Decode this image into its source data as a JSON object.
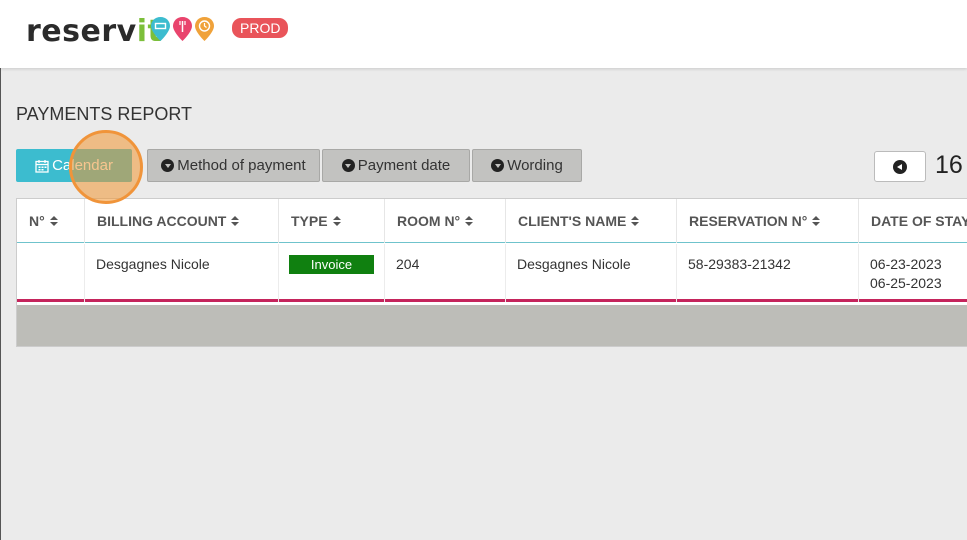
{
  "app": {
    "logo_main": "reserv",
    "logo_accent": "it",
    "env_badge": "PROD",
    "pin_colors": [
      "#3cbccf",
      "#e9446d",
      "#f0a23a"
    ]
  },
  "page": {
    "title": "PAYMENTS REPORT"
  },
  "filters": {
    "calendar": "Calendar",
    "method_of_payment": "Method of payment",
    "payment_date": "Payment date",
    "wording": "Wording"
  },
  "pager": {
    "current": "16"
  },
  "table": {
    "headers": [
      "N°",
      "BILLING ACCOUNT",
      "TYPE",
      "ROOM N°",
      "CLIENT'S NAME",
      "RESERVATION N°",
      "DATE OF STAY"
    ],
    "rows": [
      {
        "n": "",
        "billing_account": "Desgagnes Nicole",
        "type": "Invoice",
        "room": "204",
        "client_name": "Desgagnes Nicole",
        "reservation": "58-29383-21342",
        "date_from": "06-23-2023",
        "date_to": "06-25-2023"
      }
    ]
  },
  "colors": {
    "calendar_button": "#3cbccf",
    "invoice_badge": "#108010",
    "row_divider": "#c5245c",
    "env_badge": "#e9545a"
  }
}
